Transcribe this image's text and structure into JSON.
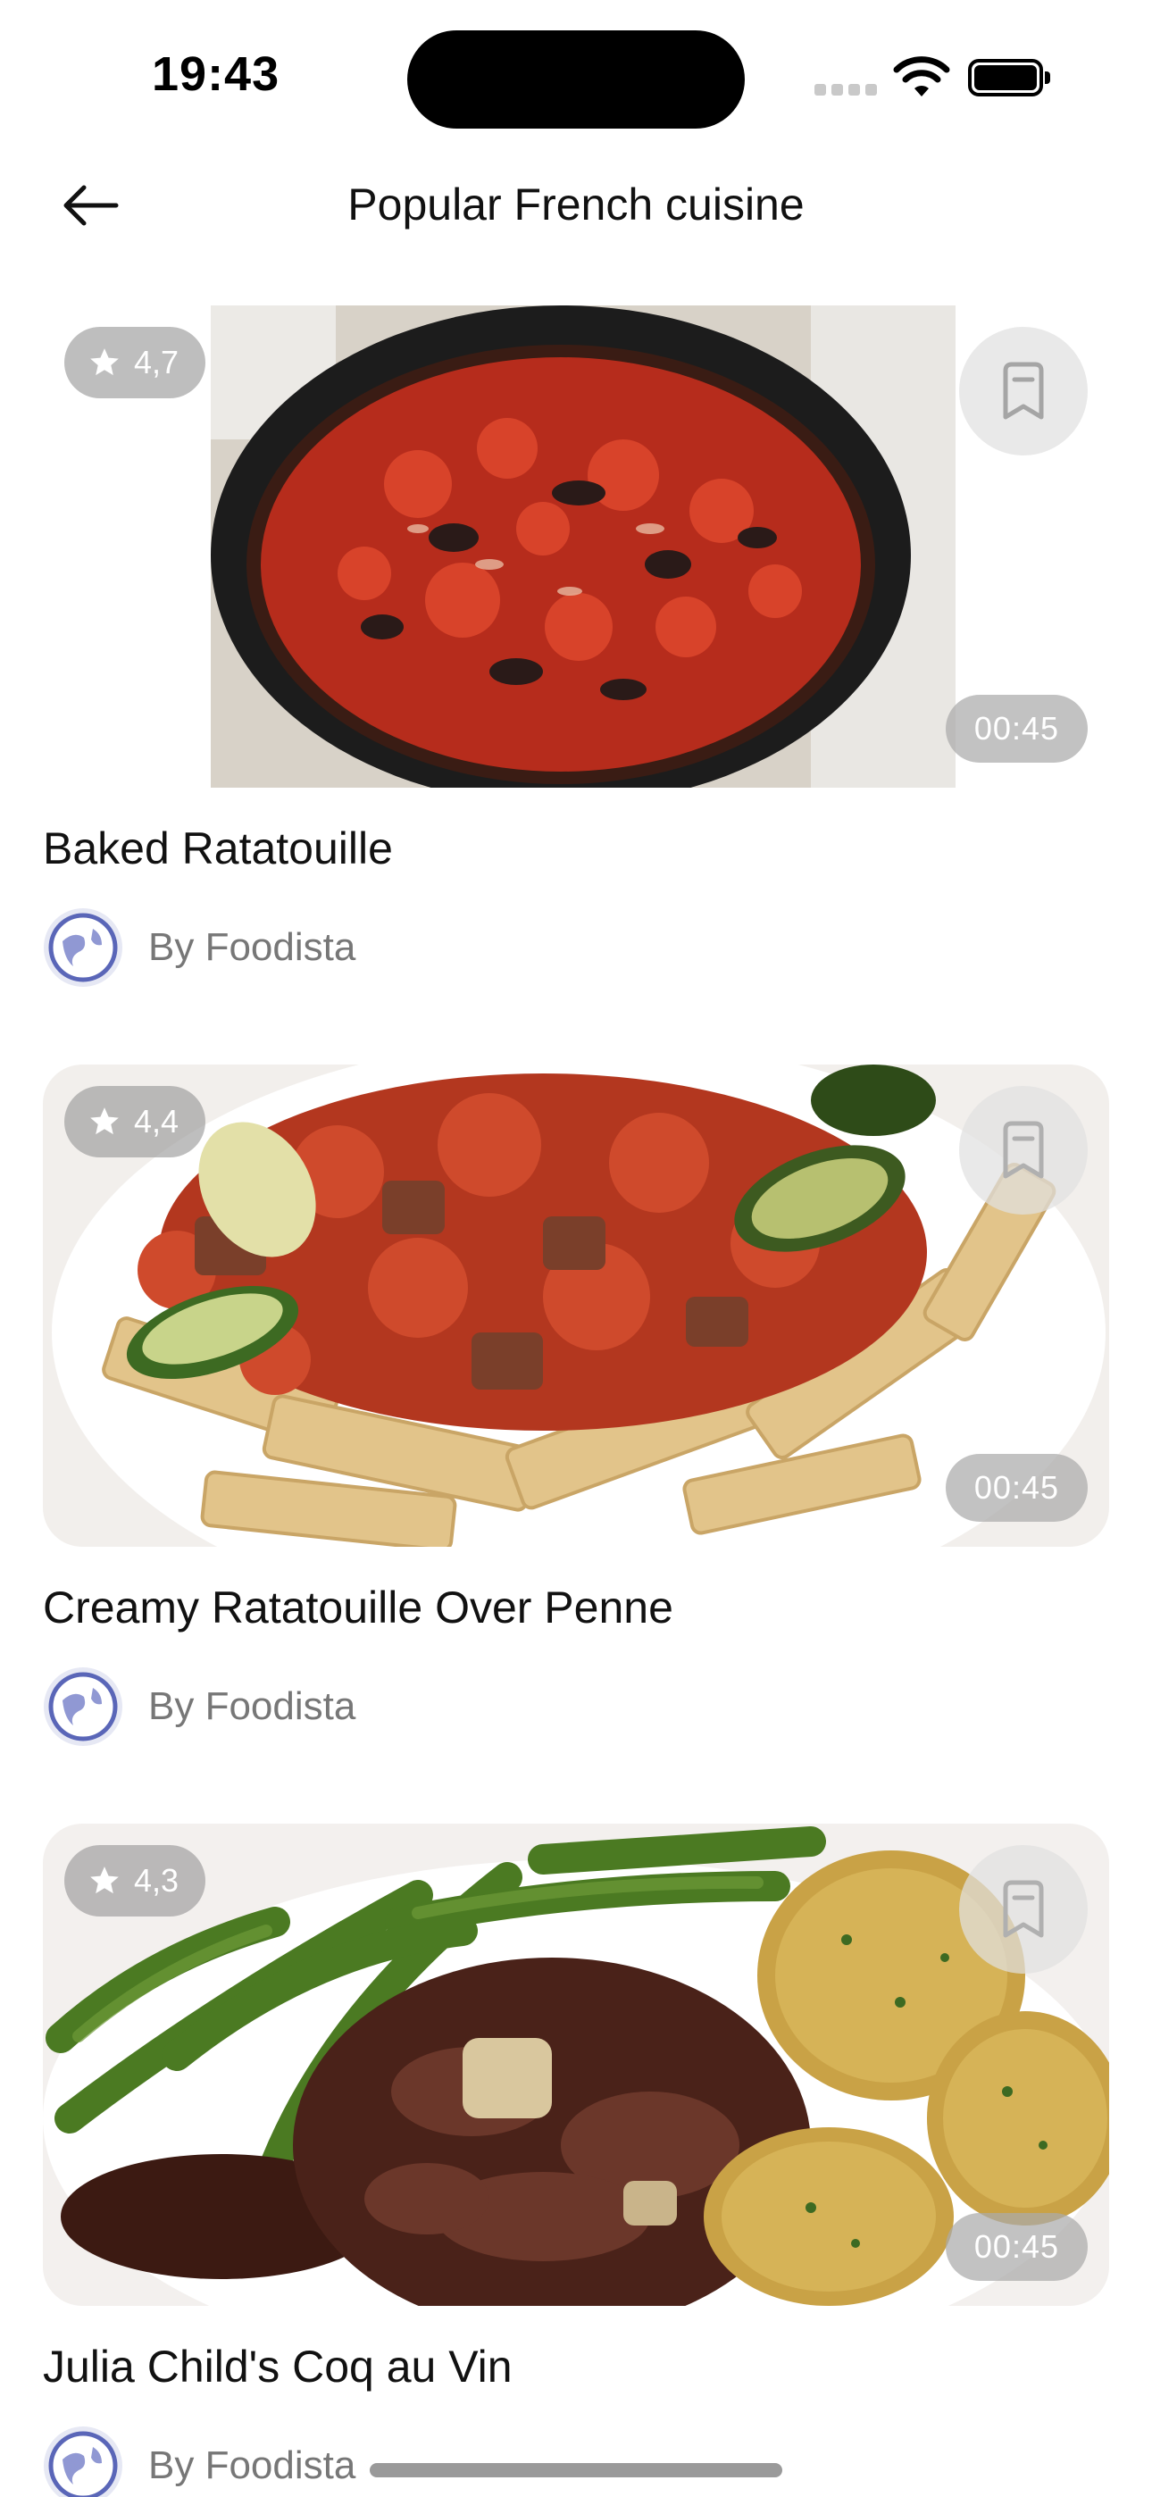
{
  "status_bar": {
    "time": "19:43",
    "wifi_icon": "wifi-icon",
    "battery_icon": "battery-icon"
  },
  "nav": {
    "title": "Popular French cuisine",
    "back_icon": "arrow-left-icon"
  },
  "recipes": [
    {
      "title": "Baked Ratatouille",
      "rating": "4,7",
      "duration": "00:45",
      "author": "By Foodista",
      "bookmark_icon": "bookmark-icon",
      "image_desc": "ratatouille-in-skillet"
    },
    {
      "title": "Creamy Ratatouille Over Penne",
      "rating": "4,4",
      "duration": "00:45",
      "author": "By Foodista",
      "bookmark_icon": "bookmark-icon",
      "image_desc": "ratatouille-penne-plate"
    },
    {
      "title": "Julia Child's Coq au Vin",
      "rating": "4,3",
      "duration": "00:45",
      "author": "By Foodista",
      "bookmark_icon": "bookmark-icon",
      "image_desc": "coq-au-vin-green-beans-potatoes"
    }
  ],
  "colors": {
    "badge_bg": "#969696",
    "author_text": "#777777",
    "title_text": "#111111"
  }
}
